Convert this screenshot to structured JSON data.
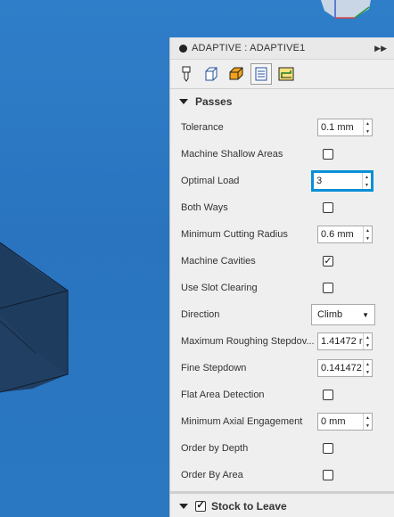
{
  "panel": {
    "title": "ADAPTIVE : ADAPTIVE1",
    "tabs": [
      {
        "name": "tool-tab-icon"
      },
      {
        "name": "geometry-tab-icon"
      },
      {
        "name": "heights-tab-icon"
      },
      {
        "name": "passes-tab-icon",
        "active": true
      },
      {
        "name": "linking-tab-icon"
      }
    ]
  },
  "passes": {
    "header": "Passes",
    "rows": [
      {
        "label": "Tolerance",
        "type": "spin",
        "value": "0.1 mm"
      },
      {
        "label": "Machine Shallow Areas",
        "type": "checkbox",
        "checked": false
      },
      {
        "label": "Optimal Load",
        "type": "spin",
        "value": "3",
        "focused": true
      },
      {
        "label": "Both Ways",
        "type": "checkbox",
        "checked": false
      },
      {
        "label": "Minimum Cutting Radius",
        "type": "spin",
        "value": "0.6 mm"
      },
      {
        "label": "Machine Cavities",
        "type": "checkbox",
        "checked": true
      },
      {
        "label": "Use Slot Clearing",
        "type": "checkbox",
        "checked": false
      },
      {
        "label": "Direction",
        "type": "select",
        "value": "Climb"
      },
      {
        "label": "Maximum Roughing Stepdov...",
        "type": "spin",
        "value": "1.41472 r"
      },
      {
        "label": "Fine Stepdown",
        "type": "spin",
        "value": "0.141472"
      },
      {
        "label": "Flat Area Detection",
        "type": "checkbox",
        "checked": false
      },
      {
        "label": "Minimum Axial Engagement",
        "type": "spin",
        "value": "0 mm"
      },
      {
        "label": "Order by Depth",
        "type": "checkbox",
        "checked": false
      },
      {
        "label": "Order By Area",
        "type": "checkbox",
        "checked": false
      }
    ]
  },
  "stock": {
    "header": "Stock to Leave",
    "checked": true
  },
  "colors": {
    "viewport": "#2e7cc6",
    "focus": "#0a8fd6",
    "model": "#1d3b5f"
  }
}
